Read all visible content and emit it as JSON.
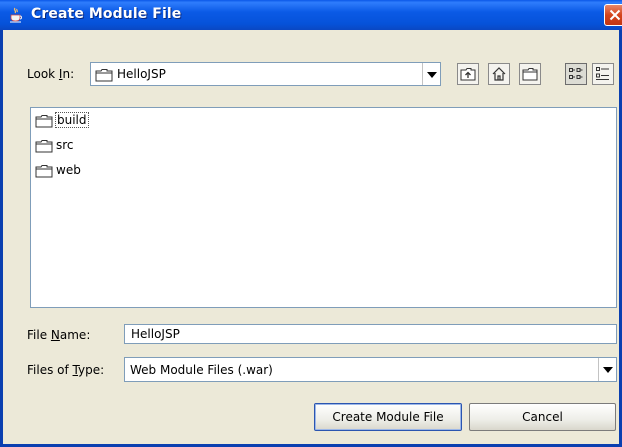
{
  "window": {
    "title": "Create Module File",
    "close_icon": "close-icon"
  },
  "look_in": {
    "label_pre": "Look ",
    "label_u": "I",
    "label_post": "n:",
    "value": "HelloJSP"
  },
  "toolbar": {
    "buttons": [
      "up-one-level-icon",
      "home-icon",
      "new-folder-icon",
      "list-view-icon",
      "details-view-icon"
    ]
  },
  "files": [
    {
      "name": "build",
      "selected": true
    },
    {
      "name": "src"
    },
    {
      "name": "web"
    }
  ],
  "file_name": {
    "label_pre": "File ",
    "label_u": "N",
    "label_post": "ame:",
    "value": "HelloJSP"
  },
  "file_type": {
    "label_pre": "Files of ",
    "label_u": "T",
    "label_post": "ype:",
    "value": "Web Module Files (.war)"
  },
  "buttons": {
    "create": "Create Module File",
    "cancel": "Cancel"
  },
  "colors": {
    "titlebar": "#0a57e8",
    "window_bg": "#ece9d8",
    "border": "#7f9db9"
  }
}
